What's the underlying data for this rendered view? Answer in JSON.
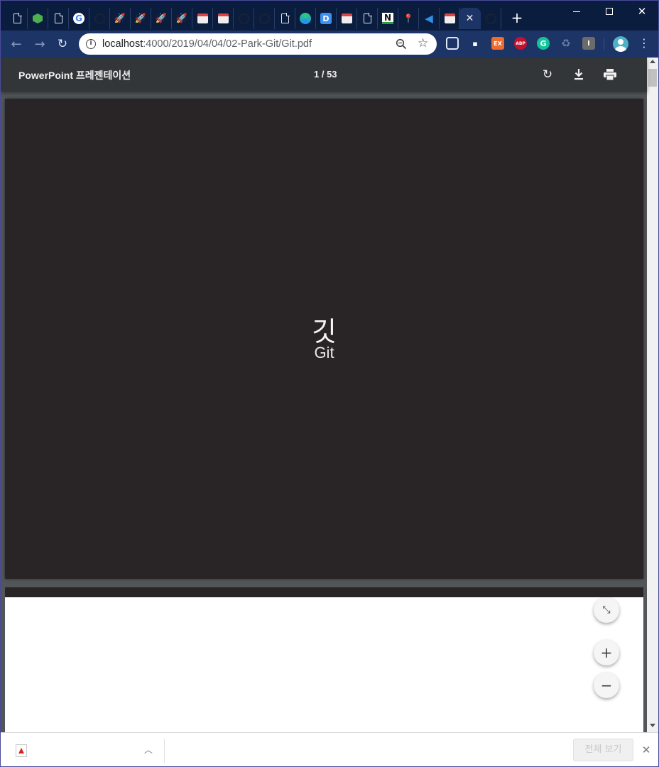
{
  "browser": {
    "tabs": [
      {
        "icon": "page-icon"
      },
      {
        "icon": "cube-icon"
      },
      {
        "icon": "page-icon"
      },
      {
        "icon": "google-icon",
        "glyph": "G"
      },
      {
        "icon": "github-icon"
      },
      {
        "icon": "rocket-icon",
        "glyph": "🚀"
      },
      {
        "icon": "rocket-icon",
        "glyph": "🚀"
      },
      {
        "icon": "rocket-icon",
        "glyph": "🚀"
      },
      {
        "icon": "rocket-icon",
        "glyph": "🚀"
      },
      {
        "icon": "calendar-icon"
      },
      {
        "icon": "calendar-icon"
      },
      {
        "icon": "github-icon"
      },
      {
        "icon": "github-icon"
      },
      {
        "icon": "page-icon"
      },
      {
        "icon": "edge-icon"
      },
      {
        "icon": "d-icon",
        "glyph": "D"
      },
      {
        "icon": "calendar-icon"
      },
      {
        "icon": "page-icon"
      },
      {
        "icon": "n-icon",
        "glyph": "N"
      },
      {
        "icon": "pin-icon",
        "glyph": "📍"
      },
      {
        "icon": "vscode-icon",
        "glyph": "◀"
      },
      {
        "icon": "calendar-icon"
      },
      {
        "icon": "close-icon",
        "glyph": "✕",
        "active": true
      },
      {
        "icon": "github-icon"
      }
    ],
    "new_tab_glyph": "+",
    "url_host": "localhost",
    "url_rest": ":4000/2019/04/04/02-Park-Git/Git.pdf",
    "extensions": [
      {
        "icon": "extension-icon",
        "label": ""
      },
      {
        "icon": "extension-icon",
        "label": "▪"
      },
      {
        "icon": "extension-icon",
        "label": "EX"
      },
      {
        "icon": "adblock-icon",
        "label": "ABP"
      },
      {
        "icon": "grammarly-icon",
        "label": "G"
      },
      {
        "icon": "recycle-icon",
        "label": "♻"
      },
      {
        "icon": "extension-icon",
        "label": "I"
      }
    ],
    "accent": "#1d3466",
    "tabstrip_color": "#0b1d3f"
  },
  "pdf": {
    "title": "PowerPoint 프레젠테이션",
    "page_indicator": "1 / 53",
    "slide": {
      "title": "깃",
      "subtitle": "Git",
      "background": "#292426"
    }
  },
  "downloads": {
    "show_all_label": "전체 보기"
  }
}
